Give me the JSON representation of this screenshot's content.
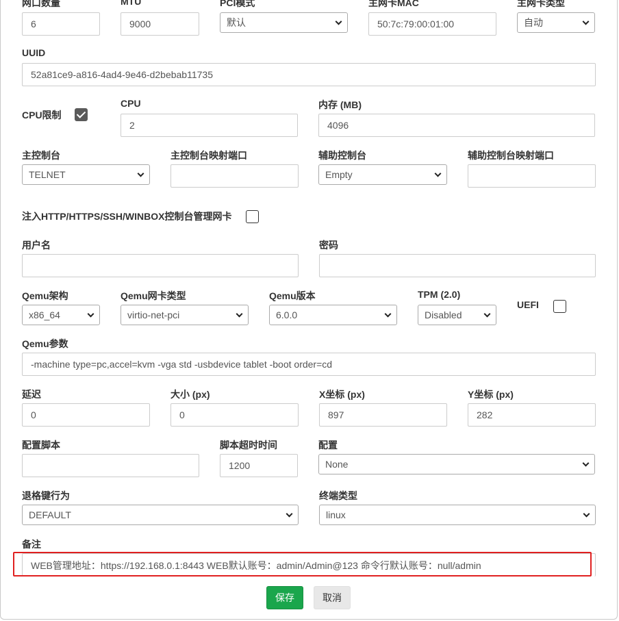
{
  "row1": {
    "ports_label": "网口数量",
    "ports_value": "6",
    "mtu_label": "MTU",
    "mtu_value": "9000",
    "pci_label": "PCI模式",
    "pci_value": "默认",
    "mac_label": "主网卡MAC",
    "mac_value": "50:7c:79:00:01:00",
    "nic_type_label": "主网卡类型",
    "nic_type_value": "自动"
  },
  "uuid": {
    "label": "UUID",
    "value": "52a81ce9-a816-4ad4-9e46-d2bebab11735"
  },
  "cpu": {
    "limit_label": "CPU限制",
    "limit_checked": true,
    "label": "CPU",
    "value": "2"
  },
  "memory": {
    "label": "内存 (MB)",
    "value": "4096"
  },
  "console": {
    "main_label": "主控制台",
    "main_value": "TELNET",
    "main_port_label": "主控制台映射端口",
    "main_port_value": "",
    "aux_label": "辅助控制台",
    "aux_value": "Empty",
    "aux_port_label": "辅助控制台映射端口",
    "aux_port_value": ""
  },
  "inject": {
    "label": "注入HTTP/HTTPS/SSH/WINBOX控制台管理网卡",
    "checked": false
  },
  "auth": {
    "username_label": "用户名",
    "username_value": "",
    "password_label": "密码",
    "password_value": ""
  },
  "qemu": {
    "arch_label": "Qemu架构",
    "arch_value": "x86_64",
    "nic_label": "Qemu网卡类型",
    "nic_value": "virtio-net-pci",
    "version_label": "Qemu版本",
    "version_value": "6.0.0",
    "tpm_label": "TPM (2.0)",
    "tpm_value": "Disabled",
    "uefi_label": "UEFI",
    "uefi_checked": false,
    "params_label": "Qemu参数",
    "params_value": "-machine type=pc,accel=kvm -vga std -usbdevice tablet -boot order=cd"
  },
  "position": {
    "delay_label": "延迟",
    "delay_value": "0",
    "size_label": "大小 (px)",
    "size_value": "0",
    "x_label": "X坐标 (px)",
    "x_value": "897",
    "y_label": "Y坐标 (px)",
    "y_value": "282"
  },
  "config": {
    "script_label": "配置脚本",
    "script_value": "",
    "timeout_label": "脚本超时时间",
    "timeout_value": "1200",
    "config_label": "配置",
    "config_value": "None"
  },
  "terminal": {
    "backspace_label": "退格键行为",
    "backspace_value": "DEFAULT",
    "type_label": "终端类型",
    "type_value": "linux"
  },
  "notes": {
    "label": "备注",
    "value": "WEB管理地址：https://192.168.0.1:8443 WEB默认账号：admin/Admin@123 命令行默认账号：null/admin"
  },
  "buttons": {
    "save": "保存",
    "cancel": "取消"
  },
  "colors": {
    "primary": "#1aa64c",
    "highlight": "#e02020"
  }
}
